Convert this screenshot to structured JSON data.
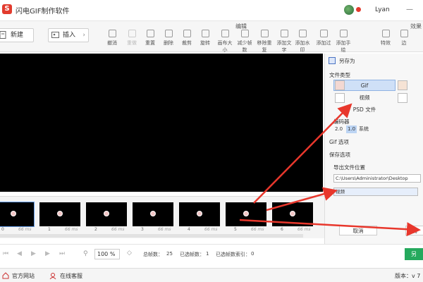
{
  "app": {
    "title": "闪电GIF制作软件",
    "logo_glyph": "S",
    "username": "Lyan"
  },
  "toolbar": {
    "new_label": "新建",
    "insert_label": "插入",
    "section_edit": "编辑",
    "section_effects": "效果",
    "tools": [
      {
        "label": "撤消",
        "icon": "undo-icon",
        "enabled": true
      },
      {
        "label": "重做",
        "icon": "redo-icon",
        "enabled": false
      },
      {
        "label": "重置",
        "icon": "reset-icon",
        "enabled": true
      },
      {
        "label": "删除",
        "icon": "delete-icon",
        "enabled": true
      },
      {
        "label": "裁剪",
        "icon": "crop-icon",
        "enabled": true
      },
      {
        "label": "旋转",
        "icon": "rotate-icon",
        "enabled": true
      },
      {
        "label": "画布大小",
        "icon": "canvas-size-icon",
        "enabled": true
      },
      {
        "label": "减少帧数",
        "icon": "reduce-frames-icon",
        "enabled": true
      },
      {
        "label": "移除重复",
        "icon": "remove-duplicates-icon",
        "enabled": true
      },
      {
        "label": "添加文字",
        "icon": "add-text-icon",
        "enabled": true
      },
      {
        "label": "添加水印",
        "icon": "add-watermark-icon",
        "enabled": true
      },
      {
        "label": "添加过",
        "icon": "add-transition-icon",
        "enabled": true
      },
      {
        "label": "添加手绘",
        "icon": "add-drawing-icon",
        "enabled": true
      },
      {
        "label": "特效",
        "icon": "effects-icon",
        "enabled": true
      },
      {
        "label": "边",
        "icon": "border-icon",
        "enabled": true
      }
    ]
  },
  "panel": {
    "save_as": "另存为",
    "file_type": "文件类型",
    "types": [
      "Gif",
      "视频",
      "PSD 文件"
    ],
    "selected_type": "Gif",
    "encoder": "编码器",
    "versions": [
      "2.0",
      "1.0",
      "系统"
    ],
    "selected_version": "1.0",
    "gif_options": "Gif 选项",
    "save_options": "保存选项",
    "export_location": "导出文件位置",
    "path_value": "C:\\Users\\Administrator\\Desktop",
    "filename_value": "视频",
    "cancel": "取消",
    "confirm": "确"
  },
  "timeline": {
    "frames": [
      {
        "index": "0",
        "duration": "66 ms"
      },
      {
        "index": "1",
        "duration": "66 ms"
      },
      {
        "index": "2",
        "duration": "66 ms"
      },
      {
        "index": "3",
        "duration": "66 ms"
      },
      {
        "index": "4",
        "duration": "66 ms"
      },
      {
        "index": "5",
        "duration": "66 ms"
      },
      {
        "index": "6",
        "duration": "66 ms"
      }
    ]
  },
  "playbar": {
    "zoom": "100",
    "zoom_unit": "%",
    "total_frames_label": "总帧数：",
    "total_frames": "25",
    "selected_label": "已选帧数：",
    "selected": "1",
    "selected_index_label": "已选帧数索引：",
    "selected_index": "0",
    "green_btn": "另"
  },
  "statusbar": {
    "website": "官方网站",
    "support": "在线客服",
    "version": "版本：v 7"
  },
  "colors": {
    "accent_red": "#e23b2e",
    "arrow_red": "#e8372c",
    "green": "#25a95d",
    "selected_blue": "#cfe0f7"
  }
}
